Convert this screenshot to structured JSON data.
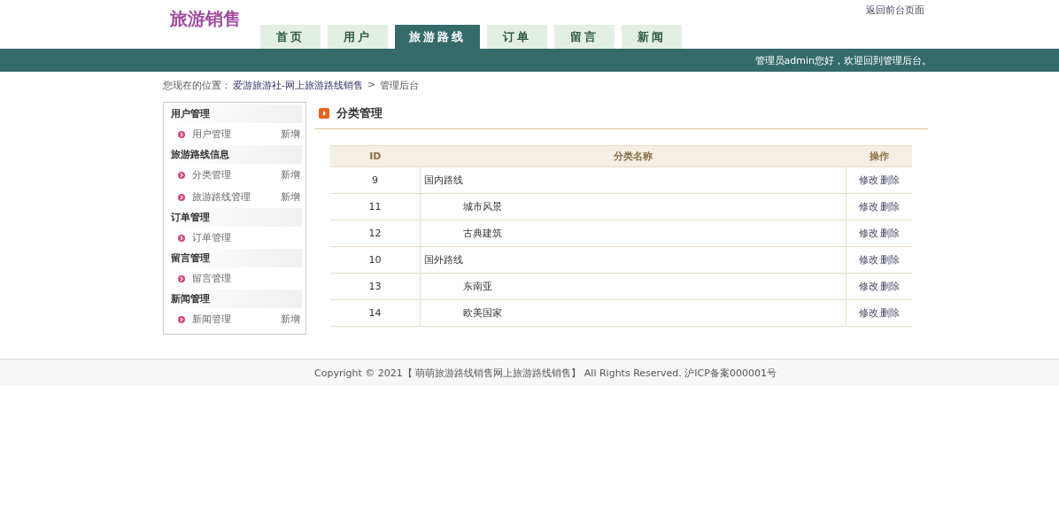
{
  "header": {
    "logo": "旅游销售",
    "back_link": "返回前台页面"
  },
  "nav": [
    {
      "label": "首页",
      "selected": false
    },
    {
      "label": "用户",
      "selected": false
    },
    {
      "label": "旅游路线",
      "selected": true
    },
    {
      "label": "订单",
      "selected": false
    },
    {
      "label": "留言",
      "selected": false
    },
    {
      "label": "新闻",
      "selected": false
    }
  ],
  "welcome": "管理员admin您好，欢迎回到管理后台。",
  "breadcrumb": {
    "prefix": "您现在的位置：",
    "link": "爱游旅游社-网上旅游路线销售",
    "separator": ">",
    "current": "管理后台"
  },
  "sidebar": [
    {
      "title": "用户管理",
      "items": [
        {
          "label": "用户管理",
          "add": "新增"
        }
      ]
    },
    {
      "title": "旅游路线信息",
      "items": [
        {
          "label": "分类管理",
          "add": "新增"
        },
        {
          "label": "旅游路线管理",
          "add": "新增"
        }
      ]
    },
    {
      "title": "订单管理",
      "items": [
        {
          "label": "订单管理"
        }
      ]
    },
    {
      "title": "留言管理",
      "items": [
        {
          "label": "留言管理"
        }
      ]
    },
    {
      "title": "新闻管理",
      "items": [
        {
          "label": "新闻管理",
          "add": "新增"
        }
      ]
    }
  ],
  "panel_title": "分类管理",
  "table": {
    "columns": [
      "ID",
      "分类名称",
      "操作"
    ],
    "rows": [
      {
        "id": "9",
        "name": "国内路线",
        "actions": [
          "修改",
          "删除"
        ],
        "children": [
          {
            "id": "11",
            "name": "城市风景",
            "actions": [
              "修改",
              "删除"
            ]
          },
          {
            "id": "12",
            "name": "古典建筑",
            "actions": [
              "修改",
              "删除"
            ]
          }
        ]
      },
      {
        "id": "10",
        "name": "国外路线",
        "actions": [
          "修改",
          "删除"
        ],
        "children": [
          {
            "id": "13",
            "name": "东南亚",
            "actions": [
              "修改",
              "删除"
            ]
          },
          {
            "id": "14",
            "name": "欧美国家",
            "actions": [
              "修改",
              "删除"
            ]
          }
        ]
      }
    ]
  },
  "footer": "Copyright © 2021【 萌萌旅游路线销售网上旅游路线销售】 All Rights Reserved. 沪ICP备案000001号"
}
